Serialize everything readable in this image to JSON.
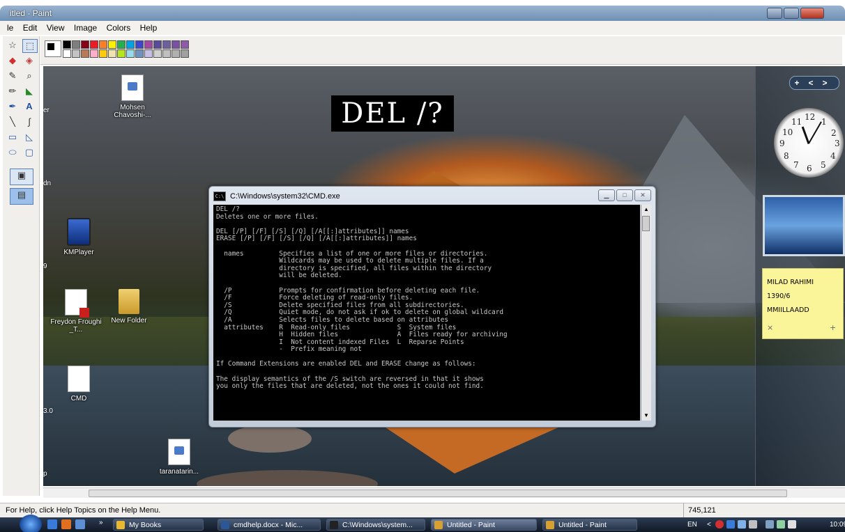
{
  "window": {
    "title": "itled - Paint"
  },
  "menu": [
    "le",
    "Edit",
    "View",
    "Image",
    "Colors",
    "Help"
  ],
  "palette_colors": [
    "#000000",
    "#7f7f7f",
    "#880015",
    "#ed1c24",
    "#ff7f27",
    "#fff200",
    "#22b14c",
    "#00a2e8",
    "#3f48cc",
    "#a349a4",
    "#5b4a9a",
    "#6b5f9f",
    "#7a4fa5",
    "#8e5aa8",
    "#ffffff",
    "#c3c3c3",
    "#b97a57",
    "#ffaec9",
    "#ffc90e",
    "#efe4b0",
    "#b5e61d",
    "#99d9ea",
    "#7092be",
    "#c8bfe7",
    "#d0d0d0",
    "#c0c0c0",
    "#b0b0b0",
    "#a0a0a0"
  ],
  "desktop": {
    "overlay_label": "DEL /?",
    "icons": [
      {
        "label": "Mohsen Chavoshi-..."
      },
      {
        "label": "KMPlayer"
      },
      {
        "label": "Freydon Froughi _T..."
      },
      {
        "label": "New Folder"
      },
      {
        "label": "CMD"
      },
      {
        "label": "taranatarin..."
      }
    ],
    "edge_labels": {
      "ver": "er",
      "dn": "dn",
      "n9": "9",
      "v30": "3.0",
      "p": "p"
    }
  },
  "cmd": {
    "title": "C:\\Windows\\system32\\CMD.exe",
    "icon_text": "C:\\",
    "lines": [
      "DEL /?",
      "Deletes one or more files.",
      "",
      "DEL [/P] [/F] [/S] [/Q] [/A[[:]attributes]] names",
      "ERASE [/P] [/F] [/S] [/Q] [/A[[:]attributes]] names",
      "",
      "  names         Specifies a list of one or more files or directories.",
      "                Wildcards may be used to delete multiple files. If a",
      "                directory is specified, all files within the directory",
      "                will be deleted.",
      "",
      "  /P            Prompts for confirmation before deleting each file.",
      "  /F            Force deleting of read-only files.",
      "  /S            Delete specified files from all subdirectories.",
      "  /Q            Quiet mode, do not ask if ok to delete on global wildcard",
      "  /A            Selects files to delete based on attributes",
      "  attributes    R  Read-only files            S  System files",
      "                H  Hidden files               A  Files ready for archiving",
      "                I  Not content indexed Files  L  Reparse Points",
      "                -  Prefix meaning not",
      "",
      "If Command Extensions are enabled DEL and ERASE change as follows:",
      "",
      "The display semantics of the /S switch are reversed in that it shows",
      "you only the files that are deleted, not the ones it could not find."
    ]
  },
  "gadgets": {
    "controls": [
      "+",
      "<",
      ">"
    ],
    "clock_numbers": [
      "12",
      "1",
      "2",
      "3",
      "4",
      "5",
      "6",
      "7",
      "8",
      "9",
      "10",
      "11"
    ],
    "sticky_note": {
      "lines": [
        "MILAD RAHIMI",
        "1390/6",
        "MMIILLAADD"
      ],
      "close": "×",
      "add": "+"
    }
  },
  "status": {
    "help_text": "For Help, click Help Topics on the Help Menu.",
    "coordinates": "745,121"
  },
  "taskbar": {
    "buttons": [
      {
        "label": "My Books",
        "color": "#e8b830"
      },
      {
        "label": "cmdhelp.docx - Mic...",
        "color": "#2b5797"
      },
      {
        "label": "C:\\Windows\\system...",
        "color": "#222222"
      },
      {
        "label": "Untitled - Paint",
        "color": "#d8a030"
      },
      {
        "label": "Untitled - Paint",
        "color": "#d8a030"
      }
    ],
    "overflow": "»",
    "language": "EN",
    "chevron": "<",
    "time": "10:09"
  }
}
